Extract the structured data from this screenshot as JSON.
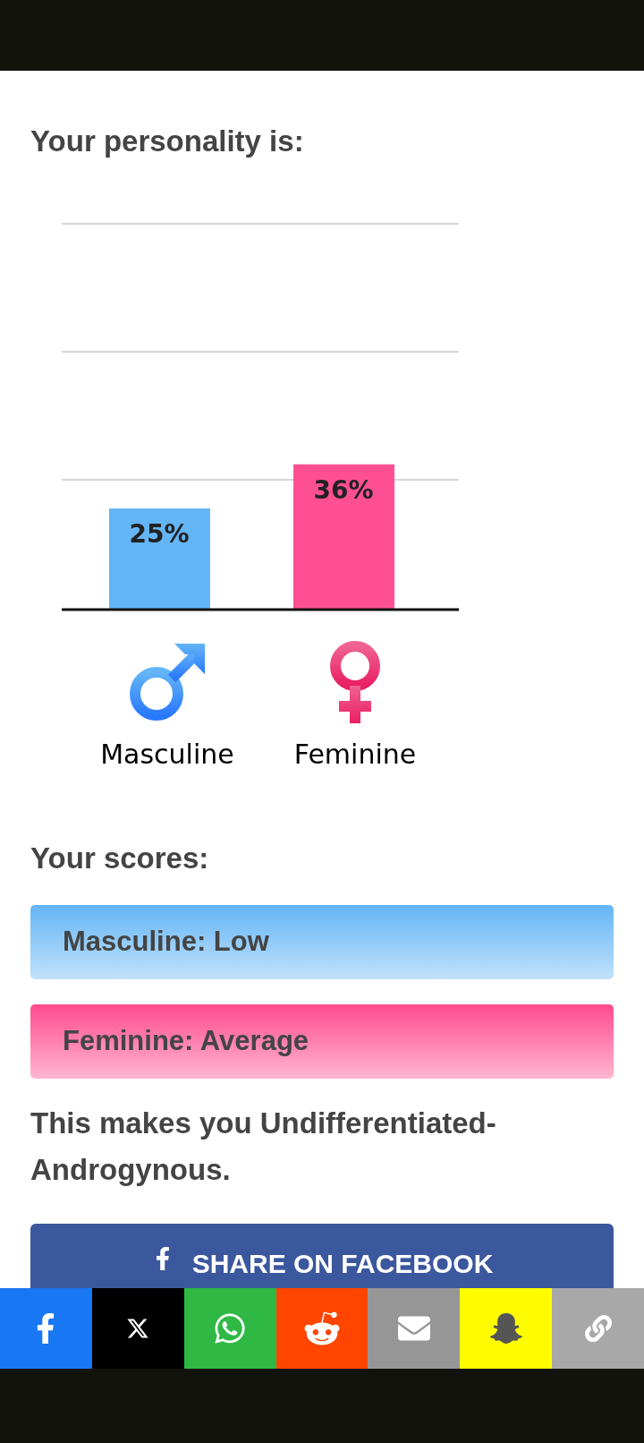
{
  "heading": "Your personality is:",
  "chart": {
    "chart_data": {
      "type": "bar",
      "categories": [
        "Masculine",
        "Feminine"
      ],
      "series": [
        {
          "color": "#64b5f6",
          "values": [
            25,
            null
          ],
          "value_labels": [
            "25%",
            null
          ]
        },
        {
          "color": "#ff4f93",
          "values": [
            null,
            36
          ],
          "value_labels": [
            null,
            "36%"
          ]
        }
      ]
    }
  },
  "scores_heading": "Your scores:",
  "scores": [
    {
      "label": "Masculine: Low",
      "color": "#64b5f6"
    },
    {
      "label": "Feminine: Average",
      "color": "#ff4a8d"
    }
  ],
  "result": "This makes you Undifferentiated-Androgynous.",
  "share_button": "SHARE ON FACEBOOK",
  "share_bar": [
    {
      "kind": "facebook",
      "color": "#1877f2"
    },
    {
      "kind": "x",
      "color": "#000000"
    },
    {
      "kind": "whatsapp",
      "color": "#2fb944"
    },
    {
      "kind": "reddit",
      "color": "#ff4500"
    },
    {
      "kind": "email",
      "color": "#969696"
    },
    {
      "kind": "snapchat",
      "color": "#fffc00"
    },
    {
      "kind": "link",
      "color": "#a8a8a8"
    }
  ]
}
